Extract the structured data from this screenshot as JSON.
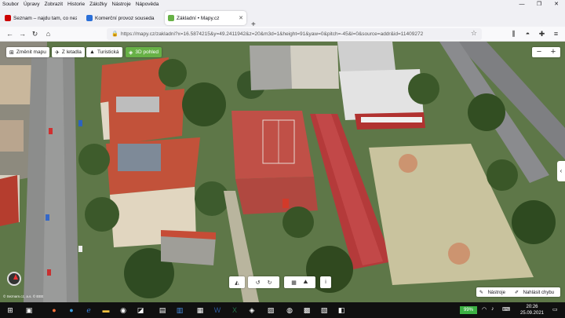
{
  "menu": [
    "Soubor",
    "Úpravy",
    "Zobrazit",
    "Historie",
    "Záložky",
    "Nástroje",
    "Nápověda"
  ],
  "tabs": [
    {
      "title": "Seznam – najdu tam, co neznám",
      "color": "#cc0000",
      "active": false
    },
    {
      "title": "Komerční provoz souseda",
      "color": "#2a6fd8",
      "active": false
    },
    {
      "title": "Základní • Mapy.cz",
      "color": "#67b146",
      "active": true
    }
  ],
  "url": "https://mapy.cz/zakladni?x=16.5874215&y=49.2411942&z=20&m3d=1&height=91&yaw=0&pitch=-45&l=0&source=addr&id=11409272",
  "map": {
    "buttons": [
      {
        "label": "Změnit mapu",
        "icon": "⊞"
      },
      {
        "label": "Z letadla",
        "icon": "✈"
      },
      {
        "label": "Turistická",
        "icon": "▲"
      },
      {
        "label": "3D pohled",
        "icon": "◈"
      }
    ],
    "zoom_in": "+",
    "zoom_out": "−",
    "side_toggle": "‹",
    "info": "i",
    "copyright": "© Seznam.cz, a.s. © EEE",
    "tools": "Nástroje",
    "report": "Nahlásit chybu"
  },
  "taskbar": {
    "battery": "99%",
    "time": "20:26",
    "date": "25.09.2021"
  }
}
